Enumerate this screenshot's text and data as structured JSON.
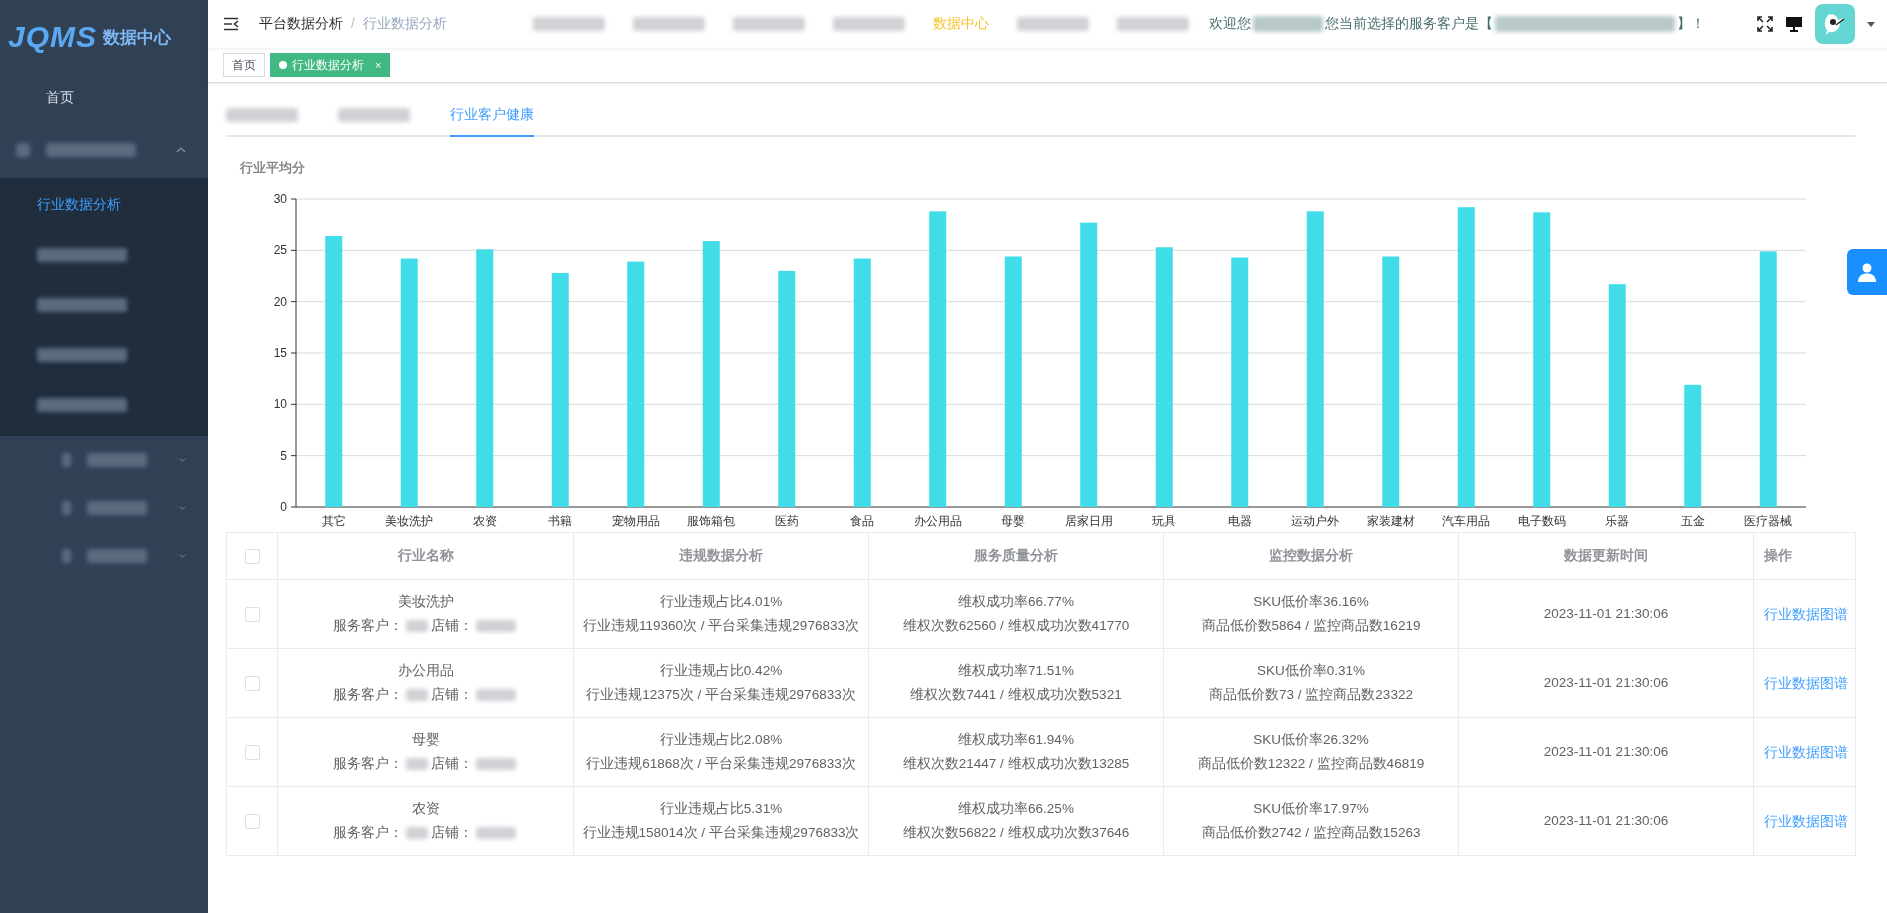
{
  "sidebar": {
    "logo": "JQMS",
    "logo_caption": "数据中心",
    "items": [
      {
        "kind": "link",
        "label": "首页",
        "selected": false
      },
      {
        "kind": "blurred",
        "expanded": true,
        "children": [
          {
            "kind": "link",
            "label": "行业数据分析",
            "selected": true
          },
          {
            "kind": "blurred"
          },
          {
            "kind": "blurred"
          },
          {
            "kind": "blurred"
          },
          {
            "kind": "blurred"
          }
        ]
      },
      {
        "kind": "blurred",
        "expanded": false
      },
      {
        "kind": "blurred",
        "expanded": false
      },
      {
        "kind": "blurred",
        "expanded": false
      }
    ]
  },
  "breadcrumb": [
    "平台数据分析",
    "行业数据分析"
  ],
  "breadcrumb_separator": "/",
  "top_nav": [
    {
      "kind": "blurred"
    },
    {
      "kind": "blurred"
    },
    {
      "kind": "blurred"
    },
    {
      "kind": "blurred"
    },
    {
      "kind": "link",
      "label": "数据中心",
      "selected": true
    },
    {
      "kind": "blurred"
    },
    {
      "kind": "blurred"
    }
  ],
  "welcome": {
    "prefix": "欢迎您",
    "middle": "您当前选择的服务客户是【",
    "suffix": "】！"
  },
  "page_tags": [
    {
      "label": "首页",
      "selected": false,
      "closable": false
    },
    {
      "label": "行业数据分析",
      "selected": true,
      "closable": true
    }
  ],
  "close_mark": "×",
  "tabs": [
    {
      "kind": "blurred",
      "selected": false
    },
    {
      "kind": "blurred",
      "selected": false
    },
    {
      "kind": "text",
      "label": "行业客户健康",
      "selected": true
    }
  ],
  "chart_section": {
    "chart_data": {
      "type": "bar",
      "grid": true,
      "categories": [
        "其它",
        "美妆洗护",
        "农资",
        "书籍",
        "宠物用品",
        "服饰箱包",
        "医药",
        "食品",
        "办公用品",
        "母婴",
        "居家日用",
        "玩具",
        "电器",
        "运动户外",
        "家装建材",
        "汽车用品",
        "电子数码",
        "乐器",
        "五金",
        "医疗器械"
      ],
      "series": [
        {
          "name": "行业平均分",
          "color": "#40dde8",
          "values": [
            26.4,
            24.2,
            25.1,
            22.8,
            23.9,
            25.9,
            23.0,
            24.2,
            28.8,
            24.4,
            27.7,
            25.3,
            24.3,
            28.8,
            24.4,
            29.2,
            28.7,
            21.7,
            11.9,
            24.9
          ]
        }
      ],
      "ylim": [
        0,
        30
      ],
      "yticks": [
        0,
        5,
        10,
        15,
        20,
        25,
        30
      ]
    }
  },
  "table": {
    "header_checked": false,
    "columns": [
      "行业名称",
      "违规数据分析",
      "服务质量分析",
      "监控数据分析",
      "数据更新时间",
      "操作"
    ],
    "rows": [
      {
        "checked": false,
        "name": "美妆洗护",
        "customer_label": "服务客户：",
        "shop_label": "店铺：",
        "violation_rate": "行业违规占比4.01%",
        "violation_counts": "行业违规119360次 / 平台采集违规2976833次",
        "service_rate": "维权成功率66.77%",
        "service_counts": "维权次数62560 / 维权成功次数41770",
        "monitor_rate": "SKU低价率36.16%",
        "monitor_counts": "商品低价数5864 / 监控商品数16219",
        "updated": "2023-11-01 21:30:06",
        "action": "行业数据图谱"
      },
      {
        "checked": false,
        "name": "办公用品",
        "customer_label": "服务客户：",
        "shop_label": "店铺：",
        "violation_rate": "行业违规占比0.42%",
        "violation_counts": "行业违规12375次 / 平台采集违规2976833次",
        "service_rate": "维权成功率71.51%",
        "service_counts": "维权次数7441 / 维权成功次数5321",
        "monitor_rate": "SKU低价率0.31%",
        "monitor_counts": "商品低价数73 / 监控商品数23322",
        "updated": "2023-11-01 21:30:06",
        "action": "行业数据图谱"
      },
      {
        "checked": false,
        "name": "母婴",
        "customer_label": "服务客户：",
        "shop_label": "店铺：",
        "violation_rate": "行业违规占比2.08%",
        "violation_counts": "行业违规61868次 / 平台采集违规2976833次",
        "service_rate": "维权成功率61.94%",
        "service_counts": "维权次数21447 / 维权成功次数13285",
        "monitor_rate": "SKU低价率26.32%",
        "monitor_counts": "商品低价数12322 / 监控商品数46819",
        "updated": "2023-11-01 21:30:06",
        "action": "行业数据图谱"
      },
      {
        "checked": false,
        "name": "农资",
        "customer_label": "服务客户：",
        "shop_label": "店铺：",
        "violation_rate": "行业违规占比5.31%",
        "violation_counts": "行业违规158014次 / 平台采集违规2976833次",
        "service_rate": "维权成功率66.25%",
        "service_counts": "维权次数56822 / 维权成功次数37646",
        "monitor_rate": "SKU低价率17.97%",
        "monitor_counts": "商品低价数2742 / 监控商品数15263",
        "updated": "2023-11-01 21:30:06",
        "action": "行业数据图谱"
      }
    ]
  }
}
